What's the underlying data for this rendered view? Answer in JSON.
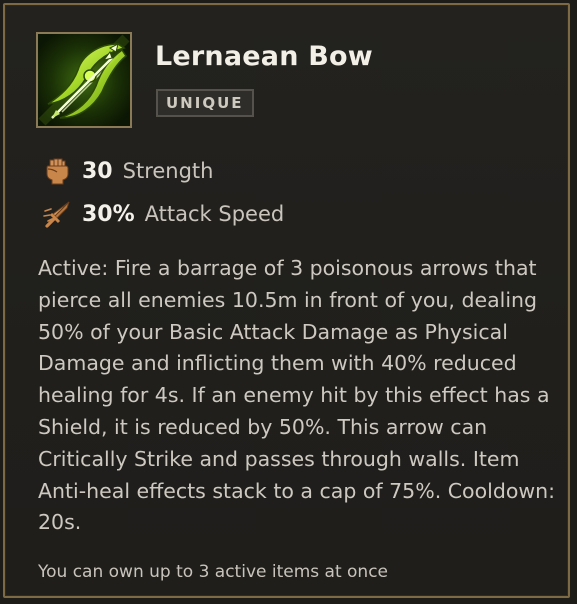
{
  "item": {
    "name": "Lernaean Bow",
    "rarity": "UNIQUE",
    "icon": "lernaean-bow-icon"
  },
  "stats": [
    {
      "value": "30",
      "name": "Strength",
      "icon": "strength-fist-icon"
    },
    {
      "value": "30%",
      "name": "Attack Speed",
      "icon": "attack-speed-icon"
    }
  ],
  "description": "Active: Fire a barrage of 3 poisonous arrows that pierce all enemies 10.5m in front of you, dealing 50% of your Basic Attack Damage as Physical Damage and inflicting them with 40% reduced healing for 4s. If an enemy hit by this effect has a Shield, it is reduced by 50%. This arrow can Critically Strike and passes through walls. Item Anti-heal effects stack to a cap of 75%. Cooldown: 20s.",
  "footer_note": "You can own up to 3 active items at once",
  "colors": {
    "panel_background": "#201f1c",
    "panel_border": "#7d6a45",
    "title_text": "#f2efe6",
    "body_text": "#cdc9c0",
    "stat_icon": "#c9864a",
    "item_icon_green": "#b8e636"
  }
}
